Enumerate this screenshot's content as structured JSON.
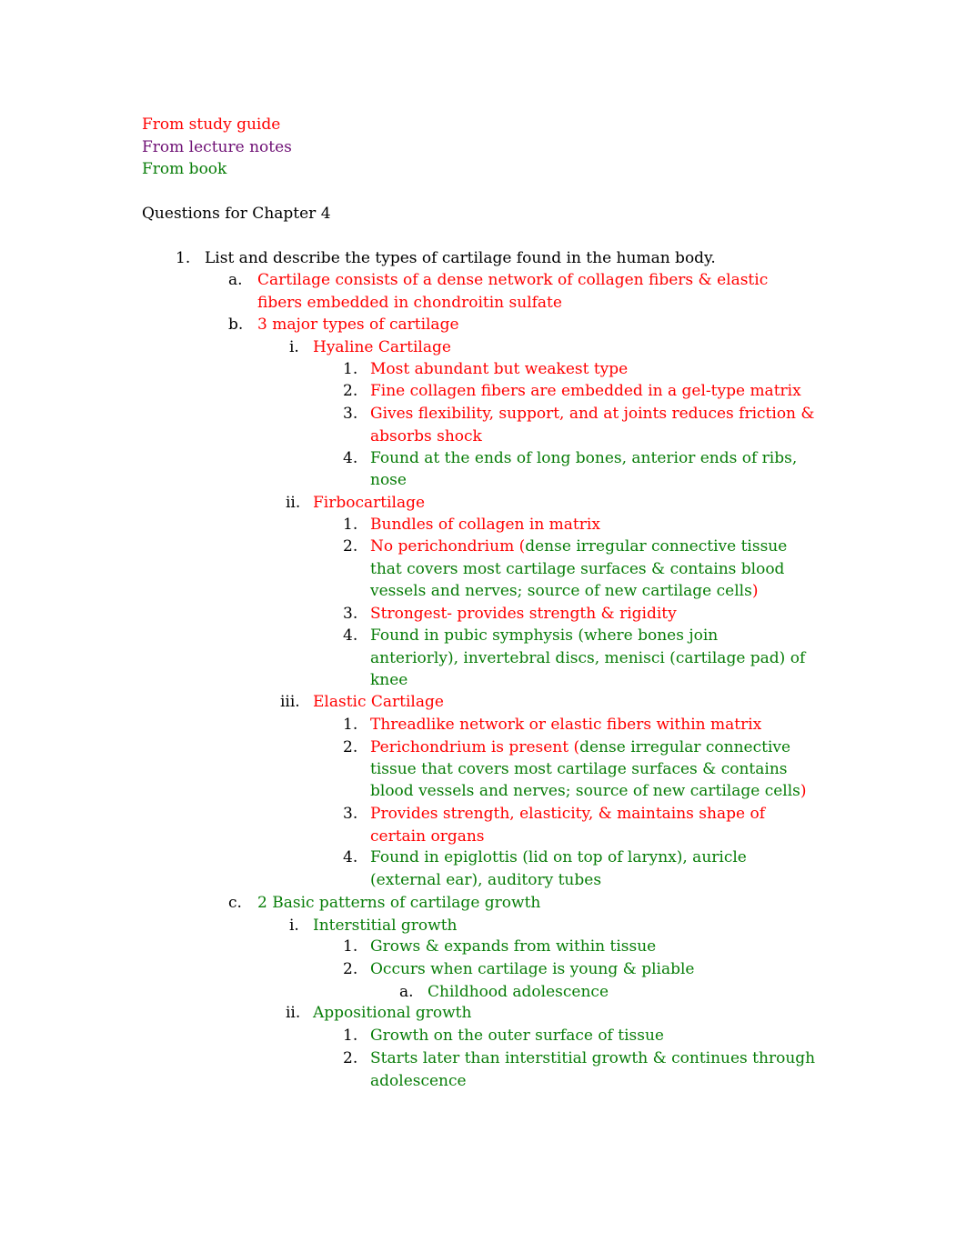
{
  "colors": {
    "study_guide": "#ff0000",
    "lecture_notes": "#6e0f74",
    "book": "#087d08",
    "text": "#000000"
  },
  "legend": {
    "study_guide": "From study guide",
    "lecture_notes": "From lecture notes",
    "book": "From book"
  },
  "heading": "Questions for Chapter 4",
  "q1": {
    "marker": "1.",
    "text": "List and describe the types of cartilage found in the human body.",
    "a": {
      "marker": "a.",
      "lines": [
        "Cartilage consists of  a dense network of collagen fibers & elastic",
        "fibers  embedded in chondroitin sulfate"
      ]
    },
    "b": {
      "marker": "b.",
      "text": "3 major types of cartilage",
      "hyaline": {
        "marker": "i.",
        "text": "Hyaline Cartilage",
        "items": [
          {
            "marker": "1.",
            "lines": [
              "Most abundant but weakest type"
            ]
          },
          {
            "marker": "2.",
            "lines": [
              "Fine collagen fibers are embedded in a gel-type matrix"
            ]
          },
          {
            "marker": "3.",
            "lines": [
              "Gives flexibility, support, and at joints reduces friction &",
              "absorbs shock"
            ]
          },
          {
            "marker": "4.",
            "lines": [
              "Found at the ends of long bones, anterior ends of ribs,",
              "nose"
            ]
          }
        ]
      },
      "fibro": {
        "marker": "ii.",
        "text": "Firbocartilage",
        "items": [
          {
            "marker": "1.",
            "lines": [
              "Bundles of collagen in matrix"
            ]
          },
          {
            "marker": "2.",
            "red_start": "No perichondrium (",
            "lines": [
              "dense irregular connective tissue",
              "that covers most cartilage surfaces  & contains blood",
              "vessels and nerves; source of new cartilage cells"
            ],
            "red_end": ")"
          },
          {
            "marker": "3.",
            "lines": [
              "Strongest- provides strength & rigidity"
            ]
          },
          {
            "marker": "4.",
            "lines": [
              "Found in pubic symphysis (where bones join",
              "anteriorly), invertebral discs, menisci (cartilage pad) of",
              "knee"
            ]
          }
        ]
      },
      "elastic": {
        "marker": "iii.",
        "text": "Elastic Cartilage",
        "items": [
          {
            "marker": "1.",
            "lines": [
              "Threadlike network or elastic fibers within matrix"
            ]
          },
          {
            "marker": "2.",
            "red_start": "Perichondrium is present (",
            "lines": [
              "dense irregular connective",
              "tissue that covers most cartilage surfaces  & contains",
              "blood vessels and nerves; source of new cartilage cells"
            ],
            "red_end": ")"
          },
          {
            "marker": "3.",
            "lines": [
              "Provides strength, elasticity, & maintains shape of",
              "certain organs"
            ]
          },
          {
            "marker": "4.",
            "lines": [
              "Found in epiglottis (lid on top of larynx), auricle",
              "(external ear), auditory tubes"
            ]
          }
        ]
      }
    },
    "c": {
      "marker": "c.",
      "text": "2 Basic patterns of cartilage growth",
      "interstitial": {
        "marker": "i.",
        "text": "Interstitial growth",
        "items": [
          {
            "marker": "1.",
            "lines": [
              "Grows & expands from within tissue"
            ]
          },
          {
            "marker": "2.",
            "lines": [
              "Occurs when cartilage is young & pliable"
            ],
            "sub": {
              "marker": "a.",
              "text": "Childhood adolescence"
            }
          }
        ]
      },
      "appositional": {
        "marker": "ii.",
        "text": "Appositional growth",
        "items": [
          {
            "marker": "1.",
            "lines": [
              "Growth on the outer surface of tissue"
            ]
          },
          {
            "marker": "2.",
            "lines": [
              "Starts later than interstitial growth & continues through",
              "adolescence"
            ]
          }
        ]
      }
    }
  }
}
